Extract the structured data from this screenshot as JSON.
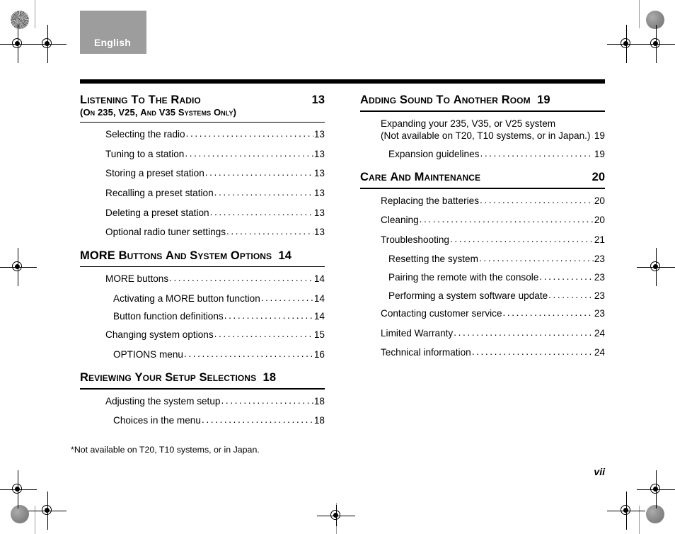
{
  "header": {
    "language_tab_label": "English",
    "tab_color": "#9d9d9d"
  },
  "footer": {
    "footnote": "*Not available on T20, T10 systems, or in Japan.",
    "page_number": "vii"
  },
  "toc": {
    "left_column": [
      {
        "id": "listening-to-the-radio",
        "title_main": "Listening to the Radio",
        "title_sub": "(on 235, V25, and V35 systems only)",
        "page": "13",
        "page_inline": false,
        "entries": [
          {
            "label": "Selecting the radio",
            "page": "13",
            "level": 1
          },
          {
            "label": "Tuning to a station",
            "page": "13",
            "level": 1
          },
          {
            "label": "Storing a preset station",
            "page": "13",
            "level": 1
          },
          {
            "label": "Recalling a preset station",
            "page": "13",
            "level": 1
          },
          {
            "label": "Deleting a preset station",
            "page": "13",
            "level": 1
          },
          {
            "label": "Optional radio tuner settings",
            "page": "13",
            "level": 1
          }
        ]
      },
      {
        "id": "more-buttons-and-system-options",
        "title_main": "MORE Buttons and System Options",
        "title_sub": "",
        "page": "14",
        "page_inline": true,
        "entries": [
          {
            "label": "MORE buttons",
            "page": "14",
            "level": 1
          },
          {
            "label": "Activating a MORE button function",
            "page": "14",
            "level": 2
          },
          {
            "label": "Button function definitions",
            "page": "14",
            "level": 2
          },
          {
            "label": "Changing system options",
            "page": "15",
            "level": 1
          },
          {
            "label": "OPTIONS menu",
            "page": "16",
            "level": 2
          }
        ]
      },
      {
        "id": "reviewing-your-setup-selections",
        "title_main": "Reviewing Your Setup Selections",
        "title_sub": "",
        "page": "18",
        "page_inline": true,
        "entries": [
          {
            "label": "Adjusting the system setup",
            "page": "18",
            "level": 1
          },
          {
            "label": "Choices in the menu",
            "page": "18",
            "level": 2
          }
        ]
      }
    ],
    "right_column": [
      {
        "id": "adding-sound-to-another-room",
        "title_main": "Adding Sound to Another Room",
        "title_sub": "",
        "page": "19",
        "page_inline": true,
        "multiline_entry": {
          "line1": "Expanding your 235, V35, or V25 system",
          "line2": "(Not available on T20, T10 systems, or in Japan.)",
          "page": "19"
        },
        "entries": [
          {
            "label": "Expansion guidelines",
            "page": "19",
            "level": 2
          }
        ]
      },
      {
        "id": "care-and-maintenance",
        "title_main": "Care and Maintenance",
        "title_sub": "",
        "page": "20",
        "page_inline": false,
        "entries": [
          {
            "label": "Replacing the batteries",
            "page": "20",
            "level": 1
          },
          {
            "label": "Cleaning",
            "page": "20",
            "level": 1
          },
          {
            "label": "Troubleshooting",
            "page": "21",
            "level": 1
          },
          {
            "label": "Resetting the system",
            "page": "23",
            "level": 2
          },
          {
            "label": "Pairing the remote with the console",
            "page": "23",
            "level": 2
          },
          {
            "label": "Performing a system software update",
            "page": "23",
            "level": 2
          },
          {
            "label": "Contacting customer service",
            "page": "23",
            "level": 1
          },
          {
            "label": "Limited Warranty",
            "page": "24",
            "level": 1
          },
          {
            "label": "Technical information",
            "page": "24",
            "level": 1
          }
        ]
      }
    ]
  }
}
